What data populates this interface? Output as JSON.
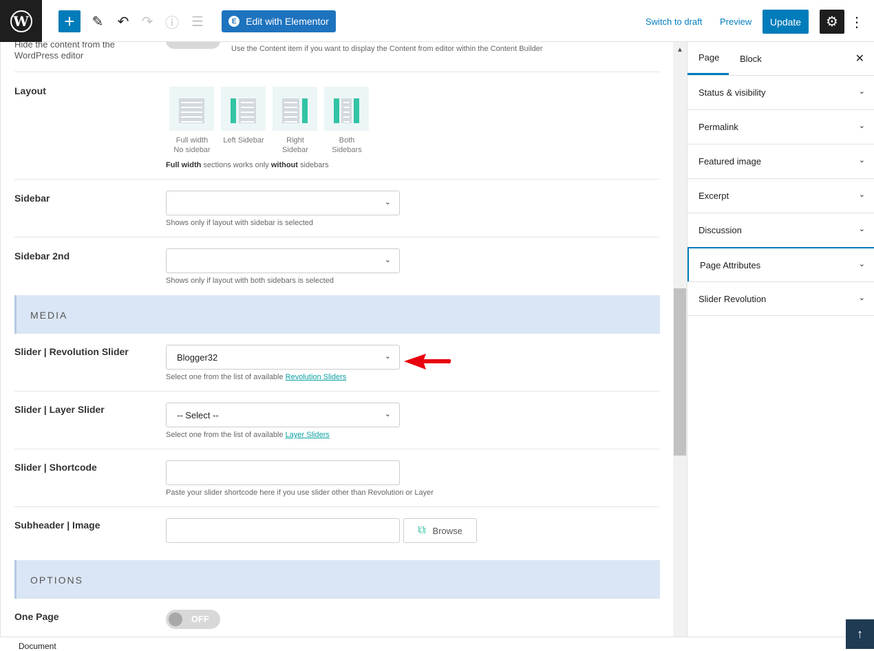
{
  "topbar": {
    "logo_letter": "W",
    "add_icon": "+",
    "edit_icon": "✎",
    "undo_icon": "↶",
    "redo_icon": "↷",
    "info_icon": "ⓘ",
    "outline_icon": "☰",
    "elementor_label": "Edit with Elementor",
    "elementor_icon": "E",
    "switch_draft": "Switch to draft",
    "preview": "Preview",
    "update": "Update",
    "gear_icon": "⚙",
    "kebab_icon": "⋮"
  },
  "content": {
    "hide_content": {
      "label": "Hide the content from the WordPress editor",
      "desc": "Use the Content item if you want to display the Content from editor within the Content Builder"
    },
    "layout": {
      "label": "Layout",
      "options": [
        {
          "line1": "Full width",
          "line2": "No sidebar"
        },
        {
          "line1": "Left Sidebar",
          "line2": ""
        },
        {
          "line1": "Right",
          "line2": "Sidebar"
        },
        {
          "line1": "Both",
          "line2": "Sidebars"
        }
      ],
      "note_bold1": "Full width",
      "note_mid": "sections works only",
      "note_bold2": "without",
      "note_end": "sidebars"
    },
    "sidebar": {
      "label": "Sidebar",
      "value": "",
      "desc": "Shows only if layout with sidebar is selected"
    },
    "sidebar2": {
      "label": "Sidebar 2nd",
      "value": "",
      "desc": "Shows only if layout with both sidebars is selected"
    },
    "media_header": "MEDIA",
    "rev_slider": {
      "label": "Slider | Revolution Slider",
      "value": "Blogger32",
      "desc": "Select one from the list of available",
      "link": "Revolution Sliders"
    },
    "layer_slider": {
      "label": "Slider | Layer Slider",
      "value": "-- Select --",
      "desc": "Select one from the list of available",
      "link": "Layer Sliders"
    },
    "shortcode": {
      "label": "Slider | Shortcode",
      "value": "",
      "desc": "Paste your slider shortcode here if you use slider other than Revolution or Layer"
    },
    "subheader_image": {
      "label": "Subheader | Image",
      "value": "",
      "browse": "Browse"
    },
    "options_header": "OPTIONS",
    "one_page": {
      "label": "One Page",
      "toggle": "OFF"
    },
    "chevron": "⌄"
  },
  "sidebar_panel": {
    "tabs": [
      "Page",
      "Block"
    ],
    "close_icon": "✕",
    "panels": [
      "Status & visibility",
      "Permalink",
      "Featured image",
      "Excerpt",
      "Discussion",
      "Page Attributes",
      "Slider Revolution"
    ],
    "chevron": "⌄"
  },
  "footer": {
    "label": "Document"
  },
  "back_top_icon": "↑",
  "scroll_up_icon": "▲",
  "colors": {
    "accent": "#007cba",
    "elementor": "#1e73be",
    "section_bg": "#dae6f5",
    "teal": "#33c3a5",
    "arrow_red": "#e8000e"
  }
}
